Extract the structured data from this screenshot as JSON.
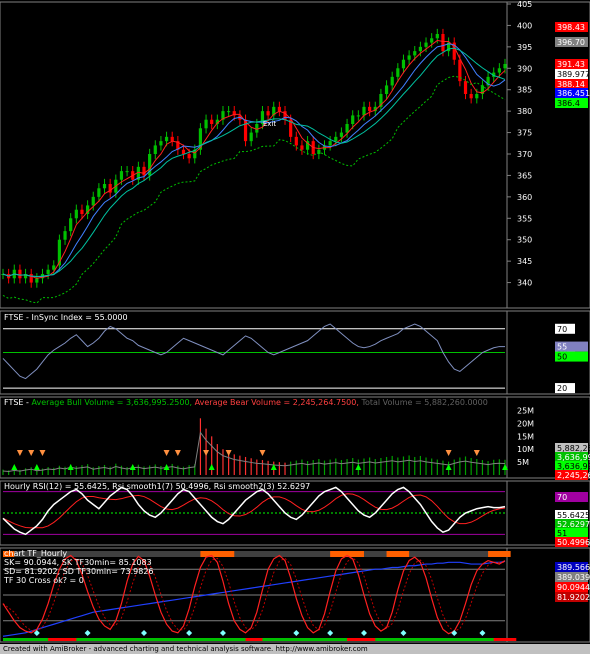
{
  "chart_data": [
    {
      "type": "candlestick",
      "panel": "price",
      "title": "",
      "ylim": [
        335,
        405
      ],
      "y_ticks": [
        340,
        345,
        350,
        355,
        360,
        365,
        370,
        375,
        380,
        385,
        390,
        395,
        400,
        405
      ],
      "close_series": [
        342,
        341,
        343,
        341,
        342,
        340,
        341,
        342,
        343,
        344,
        350,
        352,
        355,
        357,
        356,
        358,
        360,
        362,
        363,
        361,
        364,
        366,
        366,
        364,
        367,
        365,
        370,
        372,
        373,
        374,
        373,
        371,
        370,
        369,
        371,
        376,
        378,
        377,
        378,
        380,
        380,
        379,
        378,
        373,
        375,
        377,
        380,
        379,
        381,
        380,
        378,
        374,
        372,
        371,
        373,
        370,
        371,
        372,
        373,
        374,
        375,
        377,
        379,
        379,
        381,
        380,
        381,
        384,
        386,
        388,
        390,
        392,
        393,
        394,
        395,
        396,
        397,
        398,
        394,
        396,
        392,
        387,
        384,
        383,
        384,
        386,
        388,
        389,
        390,
        391
      ],
      "flag_annotation": "Exit",
      "price_labels": [
        {
          "text": "398.43",
          "color": "#ff0000"
        },
        {
          "text": "396.70",
          "color": "#808080"
        },
        {
          "text": "391.43",
          "color": "#ff0000"
        },
        {
          "text": "389.977",
          "color": "#ffffff"
        },
        {
          "text": "388.14",
          "color": "#ff0000"
        },
        {
          "text": "386.451",
          "color": "#0000ff"
        },
        {
          "text": "386.4",
          "color": "#00ff00"
        }
      ]
    },
    {
      "type": "line",
      "panel": "insync",
      "title": "FTSE - InSync Index = 55.0000",
      "ylim": [
        15,
        85
      ],
      "y_ticks": [
        20,
        50,
        70
      ],
      "levels": [
        20,
        50,
        70
      ],
      "values": [
        45,
        40,
        35,
        30,
        28,
        32,
        36,
        42,
        48,
        52,
        55,
        58,
        62,
        65,
        60,
        55,
        58,
        62,
        68,
        72,
        70,
        66,
        62,
        60,
        56,
        54,
        52,
        50,
        48,
        50,
        54,
        58,
        62,
        60,
        58,
        56,
        54,
        52,
        50,
        48,
        52,
        56,
        60,
        64,
        62,
        58,
        54,
        50,
        48,
        50,
        52,
        54,
        56,
        58,
        60,
        64,
        68,
        72,
        74,
        70,
        66,
        62,
        58,
        55,
        54,
        55,
        57,
        60,
        62,
        64,
        66,
        70,
        72,
        74,
        72,
        68,
        64,
        60,
        50,
        42,
        36,
        34,
        38,
        42,
        46,
        50,
        52,
        54,
        55,
        55
      ],
      "current_labels": [
        {
          "text": "55",
          "color": "#8080c0"
        },
        {
          "text": "50",
          "color": "#00ff00"
        }
      ]
    },
    {
      "type": "bar",
      "panel": "volume",
      "title_parts": [
        {
          "text": "FTSE - ",
          "color": "#ffffff"
        },
        {
          "text": "Average Bull Volume = 3,636,995.2500, ",
          "color": "#00c000"
        },
        {
          "text": "Average Bear Volume = 2,245,264.7500, ",
          "color": "#ff4040"
        },
        {
          "text": "Total Volume = 5,882,260.0000",
          "color": "#606060"
        }
      ],
      "ylim": [
        0,
        26000000
      ],
      "y_ticks": [
        {
          "v": 5000000,
          "t": "5M"
        },
        {
          "v": 10000000,
          "t": "10M"
        },
        {
          "v": 15000000,
          "t": "15M"
        },
        {
          "v": 20000000,
          "t": "20M"
        },
        {
          "v": 25000000,
          "t": "25M"
        }
      ],
      "values": [
        2.1,
        1.8,
        2.4,
        2.0,
        2.6,
        3.0,
        2.2,
        2.5,
        3.1,
        2.8,
        3.6,
        3.2,
        4.0,
        3.4,
        3.8,
        4.2,
        3.0,
        3.5,
        3.9,
        3.2,
        4.4,
        3.6,
        3.1,
        3.8,
        4.0,
        3.3,
        3.7,
        4.1,
        3.5,
        3.9,
        4.3,
        3.6,
        3.2,
        3.8,
        4.2,
        22.0,
        18.0,
        15.0,
        12.0,
        10.0,
        9.0,
        8.0,
        7.5,
        7.0,
        6.5,
        6.0,
        5.8,
        5.5,
        5.2,
        5.0,
        4.8,
        5.2,
        5.6,
        6.0,
        5.4,
        5.8,
        6.2,
        5.6,
        6.0,
        6.4,
        5.8,
        6.2,
        6.6,
        6.0,
        6.4,
        6.8,
        6.2,
        6.6,
        7.0,
        7.4,
        6.8,
        7.2,
        7.6,
        7.0,
        7.4,
        6.8,
        6.4,
        6.0,
        5.6,
        5.2,
        6.0,
        6.8,
        7.2,
        6.6,
        6.2,
        5.8,
        5.4,
        5.9,
        6.1,
        5.9
      ],
      "current_labels": [
        {
          "text": "5,882,260",
          "color": "#c0c0c0"
        },
        {
          "text": "3,636,995",
          "color": "#00c000"
        },
        {
          "text": "3,636,995",
          "color": "#00ff00"
        },
        {
          "text": "2,245,264",
          "color": "#ff0000"
        }
      ]
    },
    {
      "type": "line",
      "panel": "rsi",
      "title_parts": [
        {
          "text": "Hourly RSI(12) = 55.6425, ",
          "color": "#ffffff"
        },
        {
          "text": "Rsi smooth1(7) 50.4996, ",
          "color": "#ffffff"
        },
        {
          "text": "Rsi smooth2(3) 52.6297",
          "color": "#ffffff"
        }
      ],
      "ylim": [
        20,
        80
      ],
      "levels": [
        30,
        50,
        70
      ],
      "values": [
        45,
        40,
        35,
        32,
        30,
        34,
        38,
        44,
        52,
        58,
        62,
        66,
        70,
        72,
        68,
        62,
        58,
        54,
        60,
        66,
        70,
        74,
        72,
        66,
        58,
        52,
        48,
        46,
        50,
        56,
        62,
        68,
        72,
        70,
        64,
        58,
        52,
        46,
        42,
        40,
        44,
        50,
        56,
        62,
        66,
        70,
        72,
        68,
        62,
        56,
        50,
        46,
        44,
        48,
        54,
        60,
        66,
        70,
        72,
        74,
        70,
        64,
        58,
        52,
        48,
        46,
        50,
        56,
        62,
        68,
        72,
        74,
        70,
        64,
        58,
        50,
        42,
        36,
        32,
        34,
        40,
        46,
        50,
        52,
        54,
        55,
        56,
        55,
        55,
        56
      ],
      "current_labels": [
        {
          "text": "70",
          "color": "#a000a0"
        },
        {
          "text": "55.6425",
          "color": "#ffffff"
        },
        {
          "text": "52.6297",
          "color": "#00c000"
        },
        {
          "text": "51",
          "color": "#00ff00"
        },
        {
          "text": "50.4996",
          "color": "#ff0000"
        }
      ]
    },
    {
      "type": "line",
      "panel": "stochastic",
      "title_lines": [
        {
          "text": "chart TF_Hourly",
          "color": "#ffffff"
        },
        {
          "text": "SK= 90.0944,  SK TF30min= 85.1083",
          "color": "#ffffff"
        },
        {
          "text": "SD= 81.9202,  SD TF30min= 73.9826",
          "color": "#ffffff"
        },
        {
          "text": " TF 30 Cross ok? = 0",
          "color": "#ffffff"
        }
      ],
      "ylim": [
        0,
        100
      ],
      "levels": [
        20,
        50,
        80
      ],
      "values": [
        40,
        30,
        20,
        12,
        8,
        6,
        10,
        22,
        40,
        62,
        80,
        92,
        96,
        90,
        74,
        54,
        36,
        22,
        14,
        10,
        20,
        40,
        66,
        86,
        95,
        90,
        72,
        50,
        30,
        16,
        8,
        6,
        14,
        34,
        60,
        82,
        94,
        96,
        88,
        66,
        40,
        20,
        10,
        6,
        12,
        30,
        56,
        80,
        92,
        96,
        90,
        70,
        46,
        26,
        12,
        6,
        10,
        28,
        54,
        78,
        92,
        96,
        92,
        74,
        50,
        28,
        14,
        8,
        12,
        30,
        56,
        78,
        90,
        94,
        88,
        70,
        46,
        24,
        10,
        5,
        8,
        20,
        40,
        62,
        78,
        86,
        90,
        88,
        86,
        90
      ],
      "blue_values": [
        2,
        3,
        4,
        5,
        6,
        8,
        10,
        12,
        14,
        16,
        18,
        20,
        22,
        24,
        26,
        28,
        30,
        31,
        32,
        33,
        34,
        35,
        36,
        37,
        38,
        39,
        40,
        41,
        42,
        43,
        44,
        45,
        46,
        47,
        48,
        49,
        50,
        51,
        52,
        53,
        54,
        55,
        56,
        57,
        58,
        59,
        60,
        61,
        62,
        63,
        64,
        65,
        66,
        67,
        68,
        69,
        70,
        71,
        72,
        73,
        74,
        75,
        76,
        77,
        78,
        79,
        80,
        80,
        81,
        82,
        82,
        83,
        84,
        84,
        85,
        86,
        86,
        87,
        87,
        88,
        88,
        88,
        87,
        86,
        86,
        86,
        87,
        88,
        88,
        89
      ],
      "current_labels": [
        {
          "text": "389.566",
          "color": "#0000c0"
        },
        {
          "text": "389.039",
          "color": "#808080"
        },
        {
          "text": "90.0944",
          "color": "#ff0000"
        },
        {
          "text": "81.9202",
          "color": "#c00000"
        }
      ]
    }
  ],
  "footer_text": "Created with AmiBroker - advanced charting and technical analysis software. http://www.amibroker.com"
}
